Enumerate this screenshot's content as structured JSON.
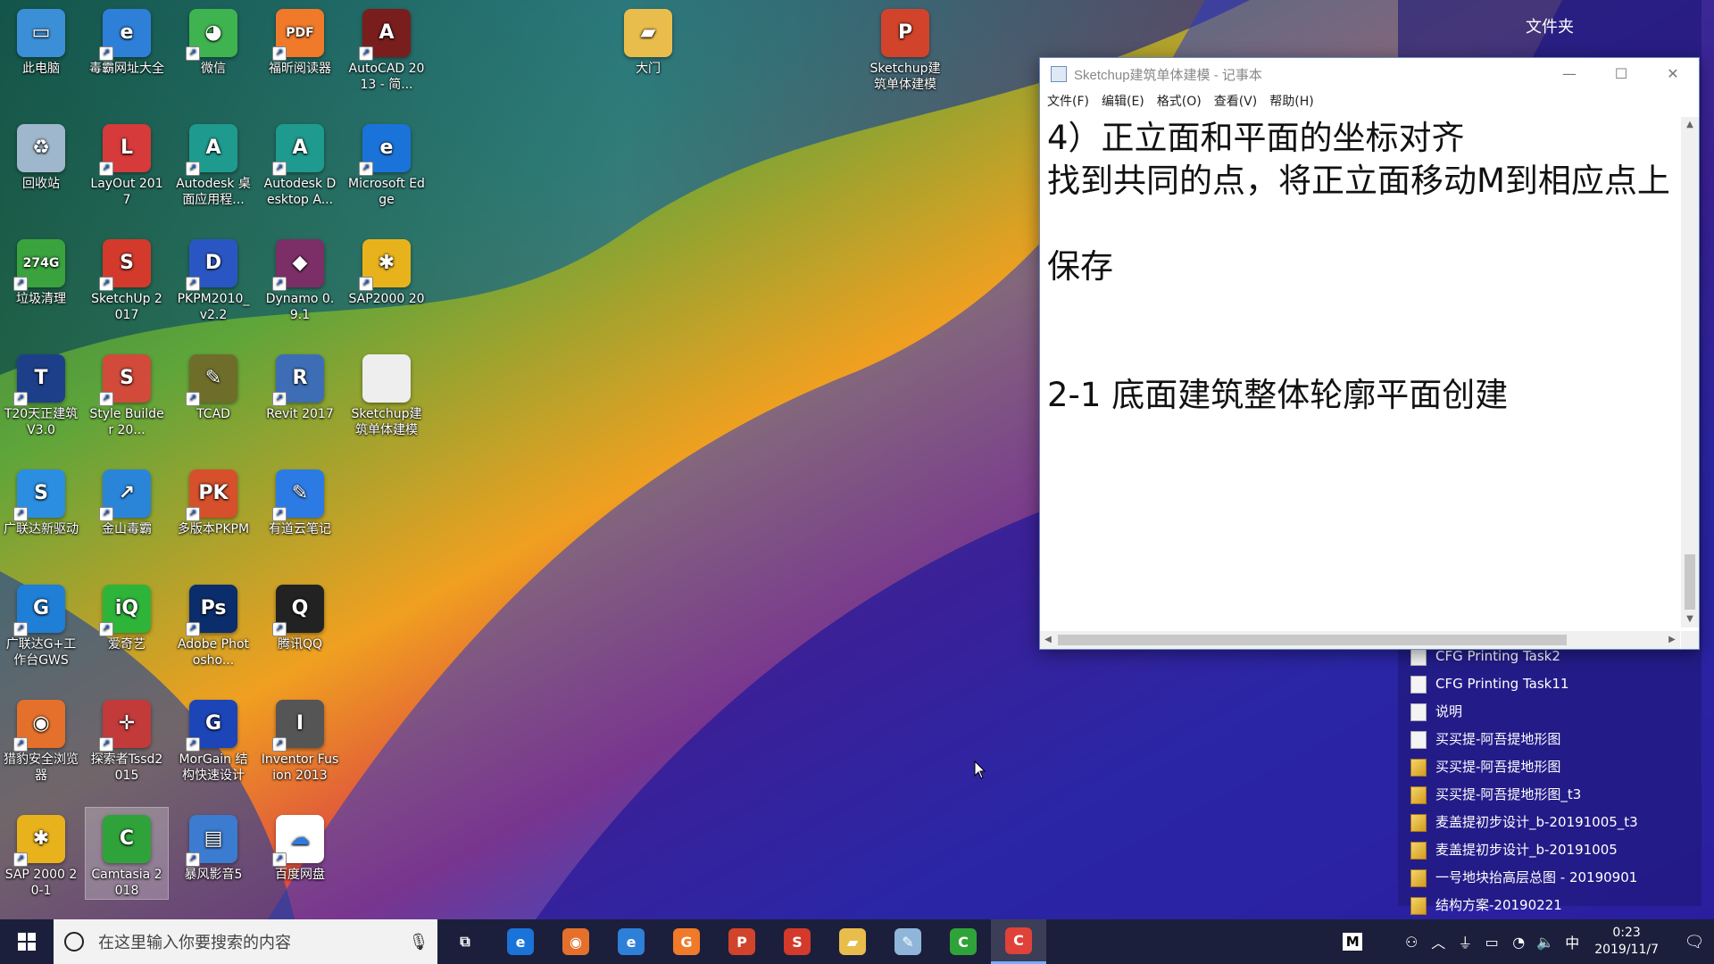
{
  "desktop_icons": [
    {
      "label": "此电脑",
      "color": "#3b8fd6",
      "glyph": "▭",
      "shortcut": false
    },
    {
      "label": "毒霸网址大全",
      "color": "#2e7fd8",
      "glyph": "e",
      "shortcut": true
    },
    {
      "label": "微信",
      "color": "#3fb34f",
      "glyph": "◕",
      "shortcut": true
    },
    {
      "label": "福昕阅读器",
      "color": "#f07a2a",
      "glyph": "PDF",
      "shortcut": true
    },
    {
      "label": "AutoCAD 2013 - 简...",
      "color": "#7a1d1d",
      "glyph": "A",
      "shortcut": true
    },
    {
      "label": "大门",
      "color": "#e9bd4c",
      "glyph": "▰",
      "shortcut": false
    },
    {
      "label": "Sketchup建筑单体建模",
      "color": "#d2432b",
      "glyph": "P",
      "shortcut": false
    },
    {
      "label": "回收站",
      "color": "#9fb7cc",
      "glyph": "♻",
      "shortcut": false
    },
    {
      "label": "LayOut 2017",
      "color": "#d63a3a",
      "glyph": "L",
      "shortcut": true
    },
    {
      "label": "Autodesk 桌面应用程...",
      "color": "#1f9a8e",
      "glyph": "A",
      "shortcut": true
    },
    {
      "label": "Autodesk Desktop A...",
      "color": "#1f9a8e",
      "glyph": "A",
      "shortcut": true
    },
    {
      "label": "Microsoft Edge",
      "color": "#1a73d9",
      "glyph": "e",
      "shortcut": true
    },
    {
      "label": "垃圾清理",
      "color": "#3aa33e",
      "glyph": "274G",
      "shortcut": true
    },
    {
      "label": "SketchUp 2017",
      "color": "#d33a2b",
      "glyph": "S",
      "shortcut": true
    },
    {
      "label": "PKPM2010_v2.2",
      "color": "#2a56c4",
      "glyph": "D",
      "shortcut": true
    },
    {
      "label": "Dynamo 0.9.1",
      "color": "#7b2f66",
      "glyph": "◆",
      "shortcut": true
    },
    {
      "label": "SAP2000 20",
      "color": "#e8b21d",
      "glyph": "✱",
      "shortcut": true
    },
    {
      "label": "T20天正建筑V3.0",
      "color": "#1d3f8a",
      "glyph": "T",
      "shortcut": true
    },
    {
      "label": "Style Builder 20...",
      "color": "#d14a3a",
      "glyph": "S",
      "shortcut": true
    },
    {
      "label": "TCAD",
      "color": "#6e6e2a",
      "glyph": "✎",
      "shortcut": true
    },
    {
      "label": "Revit 2017",
      "color": "#3d6db5",
      "glyph": "R",
      "shortcut": true
    },
    {
      "label": "Sketchup建筑单体建模",
      "color": "#eeeeee",
      "glyph": "",
      "shortcut": false
    },
    {
      "label": "广联达新驱动",
      "color": "#2b8ee0",
      "glyph": "S",
      "shortcut": true
    },
    {
      "label": "金山毒霸",
      "color": "#2a85d9",
      "glyph": "↗",
      "shortcut": true
    },
    {
      "label": "多版本PKPM",
      "color": "#d6502b",
      "glyph": "PK",
      "shortcut": true
    },
    {
      "label": "有道云笔记",
      "color": "#2c7be5",
      "glyph": "✎",
      "shortcut": true
    },
    {
      "label": "广联达G+工作台GWS",
      "color": "#1f7fd6",
      "glyph": "G",
      "shortcut": true
    },
    {
      "label": "爱奇艺",
      "color": "#2fb43a",
      "glyph": "iQ",
      "shortcut": true
    },
    {
      "label": "Adobe Photosho...",
      "color": "#0c2d6b",
      "glyph": "Ps",
      "shortcut": true
    },
    {
      "label": "腾讯QQ",
      "color": "#222222",
      "glyph": "Q",
      "shortcut": true
    },
    {
      "label": "猎豹安全浏览器",
      "color": "#e4702c",
      "glyph": "◉",
      "shortcut": true
    },
    {
      "label": "探索者Tssd2015",
      "color": "#c23a3a",
      "glyph": "✛",
      "shortcut": true
    },
    {
      "label": "MorGain 结构快速设计",
      "color": "#1c45b8",
      "glyph": "G",
      "shortcut": true
    },
    {
      "label": "Inventor Fusion 2013",
      "color": "#555555",
      "glyph": "I",
      "shortcut": true
    },
    {
      "label": "SAP 2000 20-1",
      "color": "#e8b21d",
      "glyph": "✱",
      "shortcut": true
    },
    {
      "label": "Camtasia 2018",
      "color": "#2fa33a",
      "glyph": "C",
      "shortcut": false
    },
    {
      "label": "暴风影音5",
      "color": "#3b7bd0",
      "glyph": "▤",
      "shortcut": true
    },
    {
      "label": "百度网盘",
      "color": "#ffffff",
      "glyph": "☁",
      "shortcut": true
    }
  ],
  "folder_panel": {
    "title": "文件夹",
    "items": [
      {
        "label": "CFG Printing Task2",
        "kind": "doc"
      },
      {
        "label": "CFG Printing Task11",
        "kind": "doc"
      },
      {
        "label": "说明",
        "kind": "doc"
      },
      {
        "label": "买买提-阿吾提地形图",
        "kind": "doc"
      },
      {
        "label": "买买提-阿吾提地形图",
        "kind": "skp"
      },
      {
        "label": "买买提-阿吾提地形图_t3",
        "kind": "skp"
      },
      {
        "label": "麦盖提初步设计_b-20191005_t3",
        "kind": "skp"
      },
      {
        "label": "麦盖提初步设计_b-20191005",
        "kind": "skp"
      },
      {
        "label": "一号地块抬高层总图 - 20190901",
        "kind": "skp"
      },
      {
        "label": "结构方案-20190221",
        "kind": "skp"
      }
    ]
  },
  "notepad": {
    "title": "Sketchup建筑单体建模 - 记事本",
    "minimize": "—",
    "maximize": "☐",
    "close": "✕",
    "menu": [
      "文件(F)",
      "编辑(E)",
      "格式(O)",
      "查看(V)",
      "帮助(H)"
    ],
    "lines": [
      "4）正立面和平面的坐标对齐",
      "找到共同的点，将正立面移动M到相应点上",
      "",
      "保存",
      "",
      "",
      "2-1 底面建筑整体轮廓平面创建"
    ]
  },
  "taskbar": {
    "search_placeholder": "在这里输入你要搜索的内容",
    "apps": [
      {
        "name": "task-view",
        "glyph": "⧉",
        "color": "transparent"
      },
      {
        "name": "edge",
        "glyph": "e",
        "color": "#1a73d9"
      },
      {
        "name": "cheetah-browser",
        "glyph": "◉",
        "color": "#e4702c"
      },
      {
        "name": "ie",
        "glyph": "e",
        "color": "#2e7fd8"
      },
      {
        "name": "foxit-reader",
        "glyph": "G",
        "color": "#f07a2a"
      },
      {
        "name": "powerpoint",
        "glyph": "P",
        "color": "#d2432b"
      },
      {
        "name": "sketchup",
        "glyph": "S",
        "color": "#d33a2b"
      },
      {
        "name": "file-explorer",
        "glyph": "▰",
        "color": "#e9bd4c"
      },
      {
        "name": "notepad",
        "glyph": "✎",
        "color": "#8fb6d8"
      },
      {
        "name": "camtasia",
        "glyph": "C",
        "color": "#2fa33a"
      },
      {
        "name": "camtasia-recorder",
        "glyph": "C",
        "color": "#e0423a"
      }
    ],
    "ime_mode": "M",
    "ime_lang": "中",
    "time": "0:23",
    "date": "2019/11/7"
  },
  "colors": {
    "taskbar": "#1b1f3b",
    "accent": "#7aa9ff"
  }
}
